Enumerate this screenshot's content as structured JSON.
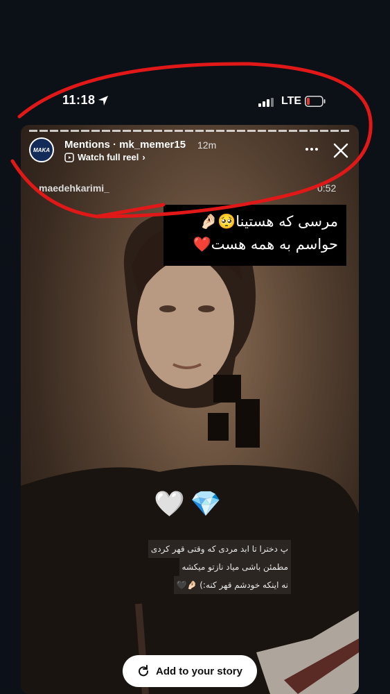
{
  "status_bar": {
    "time": "11:18",
    "network": "LTE"
  },
  "story": {
    "header": {
      "avatar_text": "MAKA",
      "title": "Mentions · mk_memer15",
      "age": "12m",
      "watch_label": "Watch full reel"
    },
    "reel": {
      "username": "maedehkarimi_",
      "duration": "0:52"
    },
    "caption_lines": [
      "مرسی که هستینا🥺🤌🏻",
      "حواسم به همه هست❤️"
    ],
    "emoji_line": [
      "🤍",
      "💎"
    ],
    "overlay_lines": [
      "پ دخترا تا ابد مردی که وقتی قهر کردی",
      "مطمئن باشی میاد نازتو میکشه",
      "نه اینکه خودشم قهر کنه:) 🤌🏻🖤"
    ],
    "add_story_label": "Add to your story"
  },
  "colors": {
    "scribble": "#e01818",
    "background": "#0b1117",
    "avatar": "#132b58"
  }
}
